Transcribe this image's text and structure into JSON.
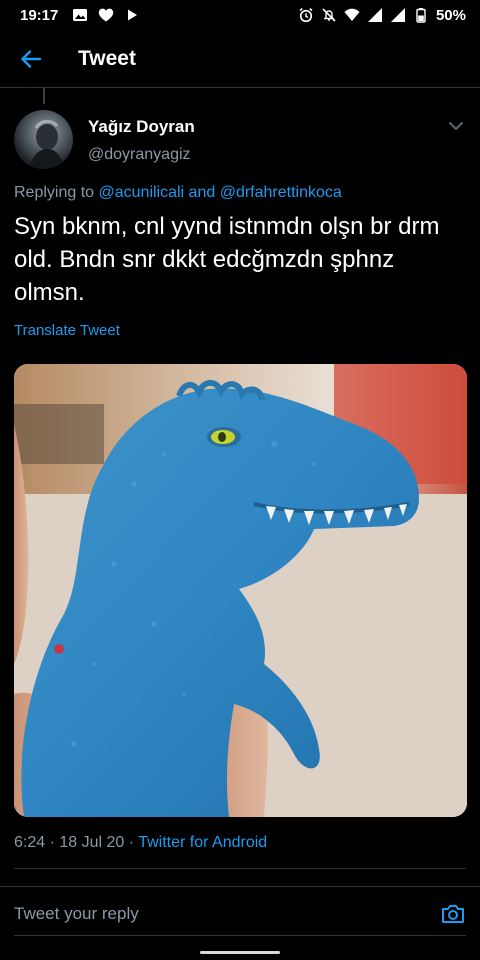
{
  "status_bar": {
    "time": "19:17",
    "battery": "50%",
    "left_icons": [
      "image-icon",
      "heart-icon",
      "play-icon"
    ],
    "right_icons": [
      "alarm-icon",
      "mute-icon",
      "wifi-icon",
      "signal-icon",
      "signal-icon",
      "battery-icon"
    ]
  },
  "header": {
    "title": "Tweet",
    "back_icon": "back-arrow-icon"
  },
  "tweet": {
    "author_name": "Yağız Doyran",
    "author_handle": "@doyranyagiz",
    "replying_prefix": "Replying to ",
    "mention_1": "@acunilicali",
    "replying_and": " and ",
    "mention_2": "@drfahrettinkoca",
    "text": "Syn bknm, cnl yynd istnmdn olşn br drm old. Bndn snr dkkt edcğmzdn şphnz olmsn.",
    "translate_label": "Translate Tweet",
    "time": "6:24",
    "date": "18 Jul 20",
    "separator": " · ",
    "source": "Twitter for Android"
  },
  "reply_box": {
    "placeholder": "Tweet your reply",
    "camera_icon": "camera-icon"
  },
  "colors": {
    "accent": "#1d9bf0",
    "background": "#000000",
    "secondary_text": "#8b98a5",
    "divider": "#2f3336"
  }
}
